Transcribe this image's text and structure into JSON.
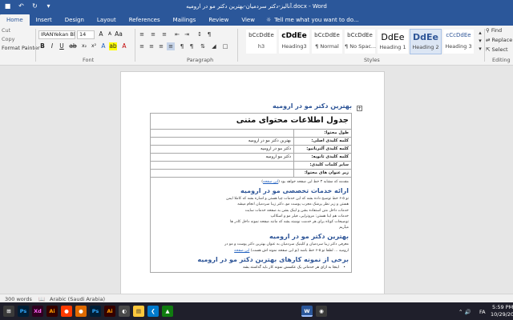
{
  "window": {
    "title": "آنالیز-دکتر سردمیان-بهترین دکتر مو در ارومیه.docx - Word"
  },
  "ribbon_tabs": [
    "Home",
    "Insert",
    "Design",
    "Layout",
    "References",
    "Mailings",
    "Review",
    "View"
  ],
  "tell_me": "Tell me what you want to do...",
  "clipboard": {
    "cut": "Cut",
    "copy": "Copy",
    "format_painter": "Format Painter"
  },
  "font": {
    "name": "IRANYekan Bla",
    "size": "14",
    "group_label": "Font"
  },
  "paragraph": {
    "group_label": "Paragraph"
  },
  "styles": {
    "group_label": "Styles",
    "items": [
      {
        "sample": "bCcDdEe",
        "name": "h3"
      },
      {
        "sample": "cDdEe",
        "name": "Heading3"
      },
      {
        "sample": "bCcDdEe",
        "name": "¶ Normal"
      },
      {
        "sample": "bCcDdEe",
        "name": "¶ No Spac..."
      },
      {
        "sample": "DdEe",
        "name": "Heading 1"
      },
      {
        "sample": "DdEe",
        "name": "Heading 2"
      },
      {
        "sample": "cCcDdEe",
        "name": "Heading 3"
      }
    ]
  },
  "editing": {
    "find": "Find",
    "replace": "Replace",
    "select": "Select",
    "group_label": "Editing"
  },
  "document": {
    "main_heading": "بهترین دکتر مو در ارومیه",
    "table_title": "جدول اطلاعات محتوای متنی",
    "rows": [
      {
        "key": "طول محتوا:",
        "value": ""
      },
      {
        "key": "کلمه کلیدی اصلی:",
        "value": "بهترین دکتر مو در ارومیه"
      },
      {
        "key": "کلمه کلیدی آلترناتیو:",
        "value": "دکتر مو در ارومیه"
      },
      {
        "key": "کلمه کلیدی ثانویه:",
        "value": "دکتر مو ارومیه"
      },
      {
        "key": "سایر کلمات کلیدی:",
        "value": ""
      }
    ],
    "subtopics_label": "زیر عنوان های محتوا:",
    "intro": "مقدمه که مشابه ۳ خط این صفحه خواهد بود",
    "intro_link": "این صفحه",
    "h2_1": "ارائه خدمات تخصصی مو در ارومیه",
    "p1_lines": [
      "تو ۵-۶ خط توضیح داده بشه که این خدمات چیا هستن و اشاره بشه که کاملا ایمن",
      "هستن و زیر نظر پزشک مجرب پوست مو، دکتر زیبا سردمیان انجام میشه",
      "خدمات داخل متن استفاده بشن و لینک بشن به صفحه خدمات سایت",
      "خدمات هم اینا هستن: مزوتراپی، فیلر مو و اسکالپ",
      "توضیحات کوتاه برای هر خدمت نوشته بشه که مانند صفحه نمونه داخل کادر ها",
      "میآریم"
    ],
    "h2_2": "بهترین دکتر مو در ارومیه",
    "p2_lines": [
      "معرفی دکتر زیبا سردمیان و کلینیک سردمیان به عنوان بهترین دکتر پوست و مو در",
      "ارومیه ... لطفا تو ۵-۶ خط باشه (تو این صفحه نمونه اش هست)"
    ],
    "p2_link": "این صفحه",
    "h2_3": "برخی از نمونه کارهای بهترین دکتر مو در ارومیه",
    "bullet_1": "اینجا به ازای هر خدماتی یک عکسش نمونه کار باید گذاشته بشه"
  },
  "status": {
    "words": "300 words",
    "language": "Arabic (Saudi Arabia)"
  },
  "taskbar": {
    "apps": [
      "Ps",
      "Xd",
      "Ai",
      "Ps",
      "Ai",
      "W"
    ],
    "time": "5:59 PM",
    "date": "10/29/20",
    "lang": "FA"
  },
  "colors": {
    "word_blue": "#2b579a",
    "heading_blue": "#2e5597"
  }
}
